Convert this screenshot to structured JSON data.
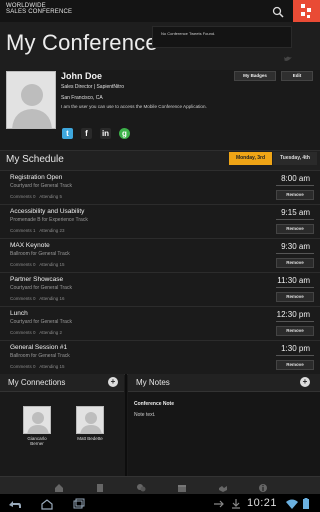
{
  "header": {
    "brand_line1": "WORLDWIDE",
    "brand_line2": "SALES CONFERENCE",
    "page_title": "My Conference",
    "notification": "No Conference Tweets Found."
  },
  "profile": {
    "name": "John Doe",
    "title": "Sales Director | SapientNitro",
    "location": "San Francisco, CA",
    "bio": "I am the user you can use to access the Mobile Conference Application.",
    "badges_label": "My Badges",
    "edit_label": "Edit",
    "social": [
      "twitter-icon",
      "facebook-icon",
      "linkedin-icon",
      "glassdoor-icon"
    ]
  },
  "schedule": {
    "title": "My Schedule",
    "tabs": [
      {
        "label": "Monday, 3rd",
        "active": true
      },
      {
        "label": "Tuesday, 4th",
        "active": false
      }
    ],
    "remove_label": "Remove",
    "sessions": [
      {
        "title": "Registration Open",
        "room": "Courtyard for General Track",
        "comments": "Comments 0",
        "attending": "Attending 5",
        "time": "8:00 am"
      },
      {
        "title": "Accessibility and Usability",
        "room": "Promenade B for Experience Track",
        "comments": "Comments 1",
        "attending": "Attending 23",
        "time": "9:15 am"
      },
      {
        "title": "MAX Keynote",
        "room": "Ballroom for General Track",
        "comments": "Comments 0",
        "attending": "Attending 15",
        "time": "9:30 am"
      },
      {
        "title": "Partner Showcase",
        "room": "Courtyard for General Track",
        "comments": "Comments 0",
        "attending": "Attending 16",
        "time": "11:30 am"
      },
      {
        "title": "Lunch",
        "room": "Courtyard for General Track",
        "comments": "Comments 0",
        "attending": "Attending 2",
        "time": "12:30 pm"
      },
      {
        "title": "General Session #1",
        "room": "Ballroom for General Track",
        "comments": "Comments 0",
        "attending": "Attending 15",
        "time": "1:30 pm"
      }
    ]
  },
  "connections": {
    "title": "My Connections",
    "people": [
      {
        "name": "Giancarlo Berner"
      },
      {
        "name": "Matt Bedette"
      }
    ]
  },
  "notes": {
    "title": "My Notes",
    "note_title": "Conference Note",
    "note_text": "Note text."
  },
  "system": {
    "clock": "10:21"
  },
  "colors": {
    "accent_orange": "#f0a516",
    "logo_red": "#e94b35"
  }
}
